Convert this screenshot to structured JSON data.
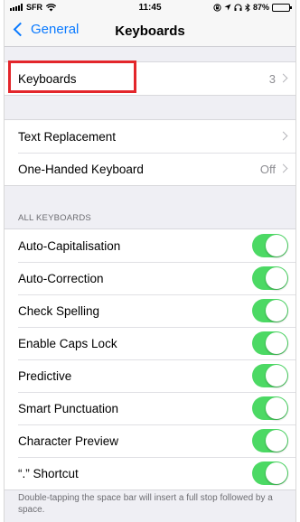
{
  "status_bar": {
    "carrier": "SFR",
    "time": "11:45",
    "battery_percent": "87%",
    "battery_level": 0.87
  },
  "nav": {
    "back_label": "General",
    "title": "Keyboards"
  },
  "keyboards_row": {
    "label": "Keyboards",
    "value": "3"
  },
  "group2": [
    {
      "label": "Text Replacement",
      "value": ""
    },
    {
      "label": "One-Handed Keyboard",
      "value": "Off"
    }
  ],
  "section_header": "ALL KEYBOARDS",
  "toggles": [
    {
      "label": "Auto-Capitalisation",
      "on": true
    },
    {
      "label": "Auto-Correction",
      "on": true
    },
    {
      "label": "Check Spelling",
      "on": true
    },
    {
      "label": "Enable Caps Lock",
      "on": true
    },
    {
      "label": "Predictive",
      "on": true
    },
    {
      "label": "Smart Punctuation",
      "on": true
    },
    {
      "label": "Character Preview",
      "on": true
    },
    {
      "label": "“.” Shortcut",
      "on": true
    }
  ],
  "footer": "Double-tapping the space bar will insert a full stop followed by a space.",
  "colors": {
    "accent": "#0a7aff",
    "toggle_on": "#4cd964",
    "highlight": "#e3262b"
  }
}
